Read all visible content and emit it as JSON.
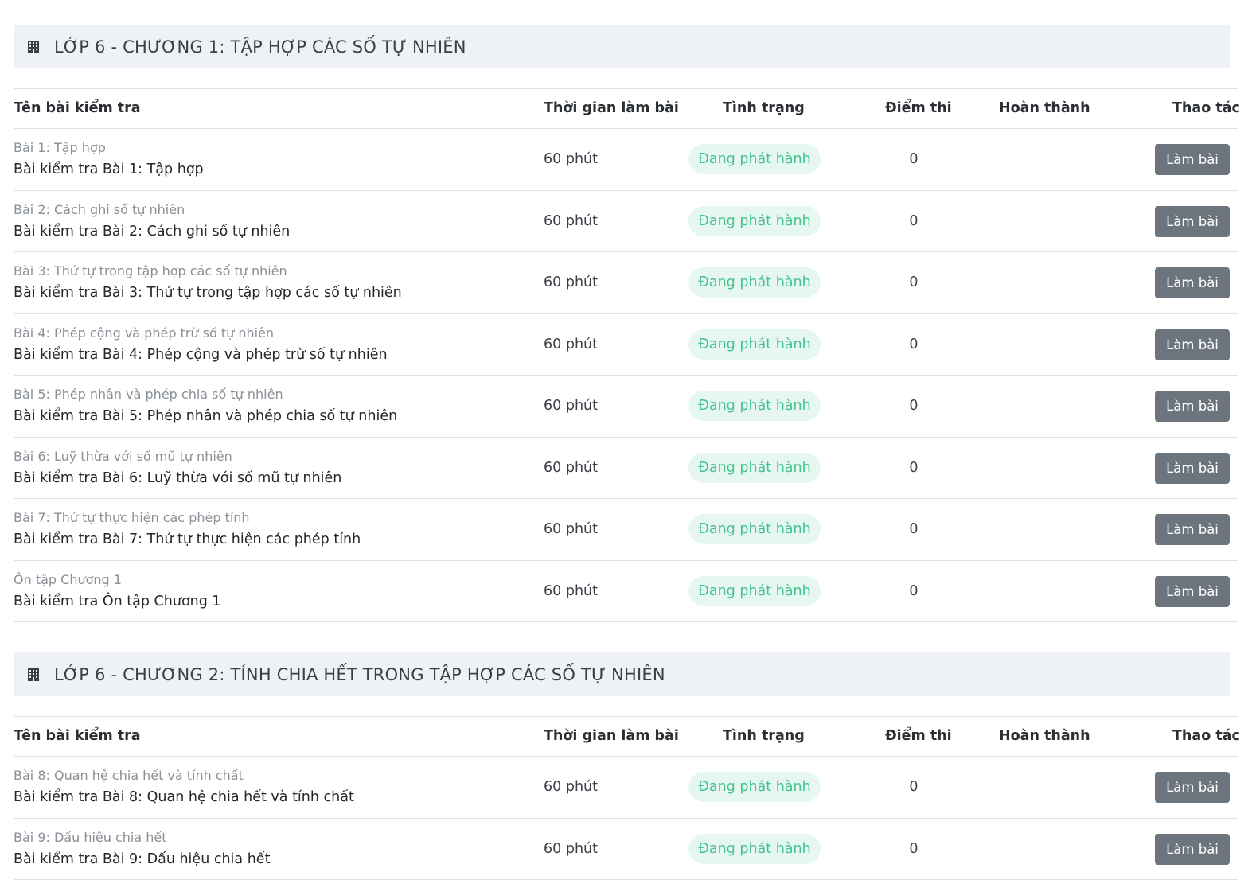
{
  "table_headers": {
    "name": "Tên bài kiểm tra",
    "time": "Thời gian làm bài",
    "status": "Tình trạng",
    "score": "Điểm thi",
    "completed": "Hoàn thành",
    "action": "Thao tác"
  },
  "icons": {
    "chapter_icon": "building-icon"
  },
  "colors": {
    "header_bg": "#eef1f5",
    "badge_bg": "#e6f7f1",
    "badge_text": "#45c38f",
    "button_bg": "#6c757d"
  },
  "chapters": [
    {
      "title": "LỚP 6 - CHƯƠNG 1: TẬP HỢP CÁC SỐ TỰ NHIÊN",
      "rows": [
        {
          "lesson": "Bài 1: Tập hợp",
          "title": "Bài kiểm tra Bài 1: Tập hợp",
          "time": "60 phút",
          "status": "Đang phát hành",
          "score": "0",
          "completed": "",
          "action": "Làm bài"
        },
        {
          "lesson": "Bài 2: Cách ghi số tự nhiên",
          "title": "Bài kiểm tra Bài 2: Cách ghi số tự nhiên",
          "time": "60 phút",
          "status": "Đang phát hành",
          "score": "0",
          "completed": "",
          "action": "Làm bài"
        },
        {
          "lesson": "Bài 3: Thứ tự trong tập hợp các số tự nhiên",
          "title": "Bài kiểm tra Bài 3: Thứ tự trong tập hợp các số tự nhiên",
          "time": "60 phút",
          "status": "Đang phát hành",
          "score": "0",
          "completed": "",
          "action": "Làm bài"
        },
        {
          "lesson": "Bài 4: Phép cộng và phép trừ số tự nhiên",
          "title": "Bài kiểm tra Bài 4: Phép cộng và phép trừ số tự nhiên",
          "time": "60 phút",
          "status": "Đang phát hành",
          "score": "0",
          "completed": "",
          "action": "Làm bài"
        },
        {
          "lesson": "Bài 5: Phép nhân và phép chia số tự nhiên",
          "title": "Bài kiểm tra Bài 5: Phép nhân và phép chia số tự nhiên",
          "time": "60 phút",
          "status": "Đang phát hành",
          "score": "0",
          "completed": "",
          "action": "Làm bài"
        },
        {
          "lesson": "Bài 6: Luỹ thừa với số mũ tự nhiên",
          "title": "Bài kiểm tra Bài 6: Luỹ thừa với số mũ tự nhiên",
          "time": "60 phút",
          "status": "Đang phát hành",
          "score": "0",
          "completed": "",
          "action": "Làm bài"
        },
        {
          "lesson": "Bài 7: Thứ tự thực hiện các phép tính",
          "title": "Bài kiểm tra Bài 7: Thứ tự thực hiện các phép tính",
          "time": "60 phút",
          "status": "Đang phát hành",
          "score": "0",
          "completed": "",
          "action": "Làm bài"
        },
        {
          "lesson": "Ôn tập Chương 1",
          "title": "Bài kiểm tra Ôn tập Chương 1",
          "time": "60 phút",
          "status": "Đang phát hành",
          "score": "0",
          "completed": "",
          "action": "Làm bài"
        }
      ]
    },
    {
      "title": "LỚP 6 - CHƯƠNG 2: TÍNH CHIA HẾT TRONG TẬP HỢP CÁC SỐ TỰ NHIÊN",
      "rows": [
        {
          "lesson": "Bài 8: Quan hệ chia hết và tính chất",
          "title": "Bài kiểm tra Bài 8: Quan hệ chia hết và tính chất",
          "time": "60 phút",
          "status": "Đang phát hành",
          "score": "0",
          "completed": "",
          "action": "Làm bài"
        },
        {
          "lesson": "Bài 9: Dấu hiệu chia hết",
          "title": "Bài kiểm tra Bài 9: Dấu hiệu chia hết",
          "time": "60 phút",
          "status": "Đang phát hành",
          "score": "0",
          "completed": "",
          "action": "Làm bài"
        }
      ]
    }
  ]
}
